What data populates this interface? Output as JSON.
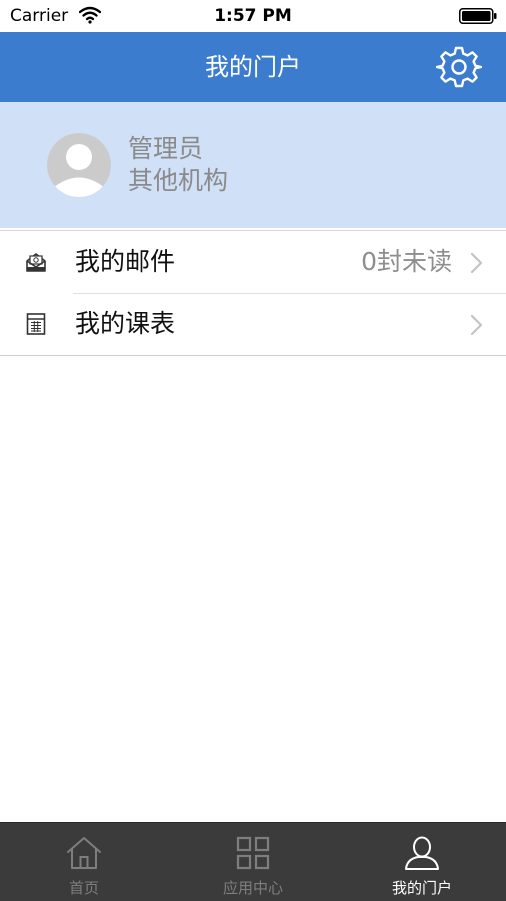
{
  "status_bar": {
    "carrier": "Carrier",
    "time": "1:57 PM",
    "icons": [
      "wifi-icon",
      "battery-icon"
    ]
  },
  "nav": {
    "title": "我的门户",
    "settings_icon": "gear-icon",
    "background_color": "#3c7ccf"
  },
  "profile": {
    "name": "管理员",
    "org": "其他机构",
    "avatar_icon": "avatar-placeholder-icon",
    "background_color": "#cfe0f7"
  },
  "list": {
    "items": [
      {
        "label": "我的邮件",
        "detail": "0封未读",
        "icon": "mail-icon"
      },
      {
        "label": "我的课表",
        "detail": "",
        "icon": "schedule-icon"
      }
    ]
  },
  "tabbar": {
    "background_color": "#3b3b3b",
    "tabs": [
      {
        "label": "首页",
        "icon": "home-icon",
        "active": false
      },
      {
        "label": "应用中心",
        "icon": "grid-icon",
        "active": false
      },
      {
        "label": "我的门户",
        "icon": "user-icon",
        "active": true
      }
    ]
  }
}
